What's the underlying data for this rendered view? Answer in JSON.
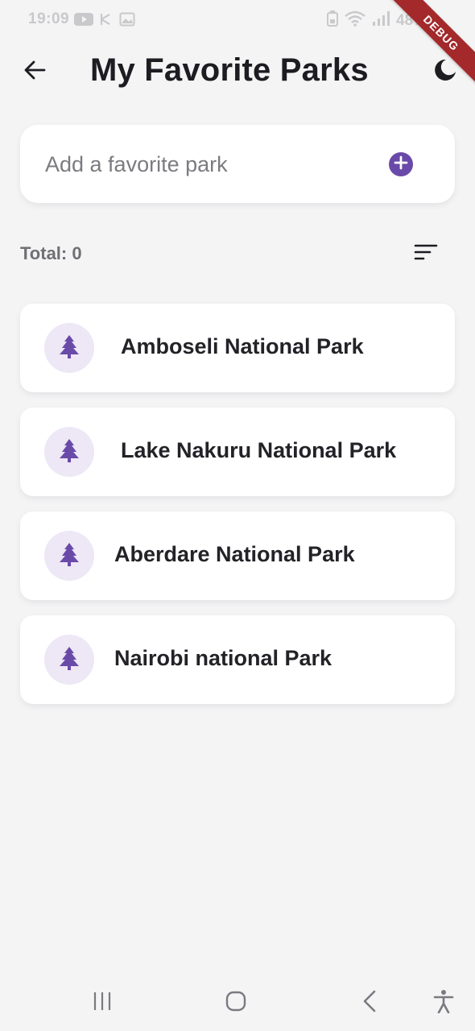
{
  "status_bar": {
    "time": "19:09",
    "battery": "48%",
    "icons_left": [
      "youtube-icon",
      "usb-icon",
      "image-icon"
    ],
    "icons_right": [
      "battery-saver-icon",
      "wifi-icon",
      "signal-icon"
    ]
  },
  "debug_banner": "DEBUG",
  "app_bar": {
    "title": "My Favorite Parks",
    "back_icon": "arrow-left-icon",
    "theme_icon": "moon-icon"
  },
  "add_park": {
    "placeholder": "Add a favorite park",
    "button_icon": "plus-circle-icon"
  },
  "summary": {
    "total_label": "Total: 0",
    "sort_icon": "sort-icon"
  },
  "parks": [
    {
      "name": "Amboseli National Park",
      "icon": "tree-icon"
    },
    {
      "name": "Lake Nakuru National Park",
      "icon": "tree-icon"
    },
    {
      "name": "Aberdare National Park",
      "icon": "tree-icon"
    },
    {
      "name": "Nairobi national Park",
      "icon": "tree-icon"
    }
  ],
  "nav_bar": [
    "recents-icon",
    "home-icon",
    "back-icon",
    "accessibility-icon"
  ],
  "colors": {
    "accent": "#6a4aa8",
    "avatar_bg": "#ede7f6",
    "background": "#f4f4f5",
    "card": "#ffffff",
    "debug": "#a3292b"
  }
}
